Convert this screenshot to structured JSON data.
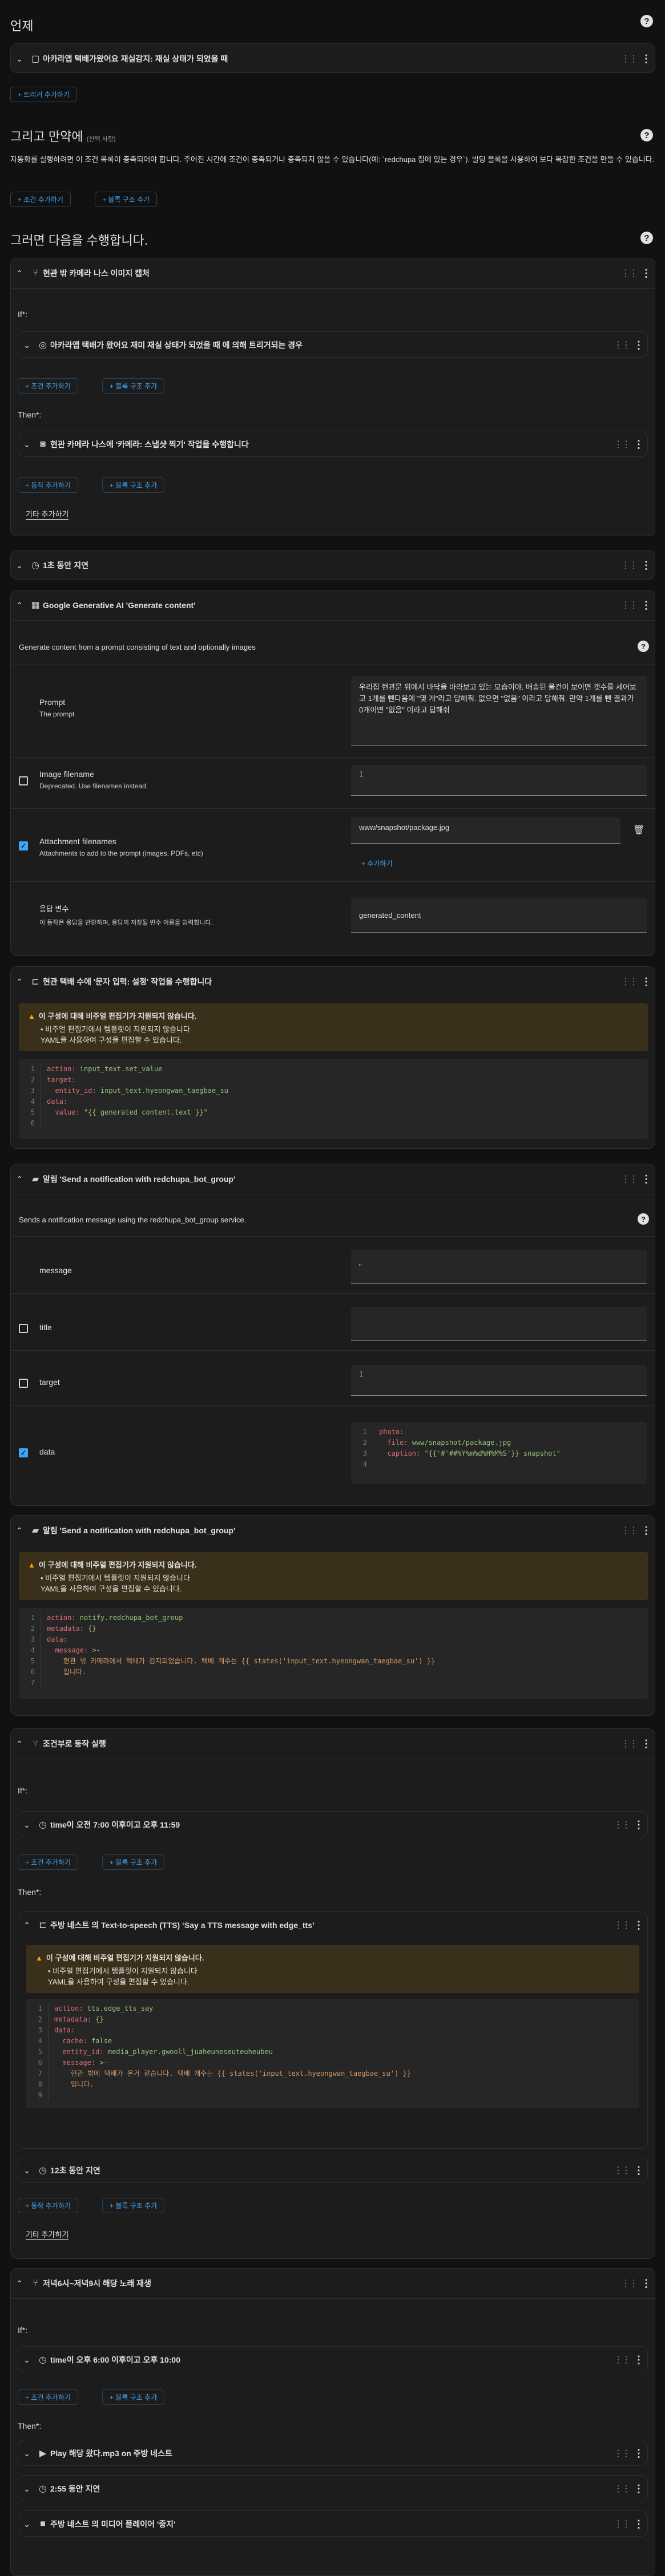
{
  "header": {
    "title": "언제"
  },
  "when": {
    "trigger_title": "아카라앱 택배가왔어요 재실감지: 재실 상태가 되었을 때",
    "add_trigger": "트리거 추가하기"
  },
  "and_if": {
    "title": "그리고 만약에",
    "optional": "(선택 사항)",
    "description": "자동화를 실행하려면 이 조건 목록이 충족되어야 합니다. 주어진 시간에 조건이 충족되거나 충족되지 않을 수 있습니다(예: `redchupa 집에 있는 경우`). 빌딩 블록을 사용하여 보다 복잡한 조건을 만들 수 있습니다.",
    "add_condition": "조건 추가하기",
    "add_block": "블록 구조 추가"
  },
  "then_do": {
    "title": "그러면 다음을 수행합니다."
  },
  "labels": {
    "if": "If*:",
    "then": "Then*:",
    "else_add": "기타 추가하기",
    "add_action": "동작 추가하기",
    "add_condition": "조건 추가하기",
    "add_block": "블록 구조 추가"
  },
  "actions": {
    "a1": {
      "title": "현관 밖 카메라 나스 이미지 캡처",
      "if_title": "아카라앱 택배가 왔어요 재미 재실 상태가 되었을 때 에 의해 트리거되는 경우",
      "then_title": "현관 카메라 나스에 '카메라: 스냅샷 찍기' 작업을 수행합니다"
    },
    "a2": {
      "title": "1초 동안 지연"
    },
    "a3": {
      "title": "Google Generative AI 'Generate content'",
      "description": "Generate content from a prompt consisting of text and optionally images",
      "prompt_label": "Prompt",
      "prompt_desc": "The prompt",
      "prompt_value": "우리집 현관문 위에서 바닥을 바라보고 있는 모습이야. 배송된 물건이 보이면 갯수를 세어보고 1개를 뺀다음에 \"몇 개\"라고 답해줘. 없으면 \"없음\" 이라고 답해줘. 만약 1개를 뺀 결과가 0개이면 \"없음\" 이라고 답해줘",
      "image_label": "Image filename",
      "image_desc": "Deprecated. Use filenames instead.",
      "image_line": "1",
      "attach_label": "Attachment filenames",
      "attach_desc": "Attachments to add to the prompt (images, PDFs, etc)",
      "attach_value": "www/snapshot/package.jpg",
      "attach_add": "추가하기",
      "resp_label": "응답 변수",
      "resp_desc": "이 동작은 응답을 반환하며, 응답의 저장될 변수 이름을 입력합니다.",
      "resp_value": "generated_content"
    },
    "a4": {
      "title": "현관 택배 수에 '문자 입력: 설정' 작업을 수행합니다",
      "warn_title": "이 구성에 대해 비주얼 편집기가 지원되지 않습니다.",
      "warn_line1": "비주얼 편집기에서 템플릿이 지원되지 않습니다",
      "warn_line2": "YAML을 사용하여 구성을 편집할 수 있습니다.",
      "code": [
        "action: input_text.set_value",
        "target:",
        "  entity_id: input_text.hyeongwan_taegbae_su",
        "data:",
        "  value: \"{{ generated_content.text }}\"",
        ""
      ]
    },
    "a5": {
      "title": "알림 'Send a notification with redchupa_bot_group'",
      "description": "Sends a notification message using the redchupa_bot_group service.",
      "message_label": "message",
      "message_value": "\"",
      "title_label": "title",
      "target_label": "target",
      "target_line": "1",
      "data_label": "data",
      "data_code": [
        "photo:",
        "  file: www/snapshot/package.jpg",
        "  caption: \"{{'#'##%Y%m%d%H%M%S'}} snapshot\"",
        ""
      ]
    },
    "a6": {
      "title": "알림 'Send a notification with redchupa_bot_group'",
      "warn_title": "이 구성에 대해 비주얼 편집기가 지원되지 않습니다.",
      "warn_line1": "비주얼 편집기에서 템플릿이 지원되지 않습니다",
      "warn_line2": "YAML을 사용하여 구성을 편집할 수 있습니다.",
      "code": [
        "action: notify.redchupa_bot_group",
        "metadata: {}",
        "data:",
        "  message: >-",
        "    현관 밖 카메라에서 택배가 감지되었습니다. 택배 개수는 {{ states('input_text.hyeongwan_taegbae_su') }}",
        "    입니다.",
        ""
      ]
    },
    "a7": {
      "title": "조건부로 동작 실행",
      "if_title": "time이 오전 7:00 이후이고 오후 11:59",
      "then_title": "주방 네스트 의 Text-to-speech (TTS) ‘Say a TTS message with edge_tts’",
      "warn_title": "이 구성에 대해 비주얼 편집기가 지원되지 않습니다.",
      "warn_line1": "비주얼 편집기에서 템플릿이 지원되지 않습니다",
      "warn_line2": "YAML을 사용하여 구성을 편집할 수 있습니다.",
      "code": [
        "action: tts.edge_tts_say",
        "metadata: {}",
        "data:",
        "  cache: false",
        "  entity_id: media_player.gwooll_juaheuneseuteuheubeu",
        "  message: >-",
        "    현관 밖에 택배가 온거 같습니다. 택배 개수는 {{ states('input_text.hyeongwan_taegbae_su') }}",
        "    입니다.",
        ""
      ],
      "delay_title": "12초 동안 지연"
    },
    "a8": {
      "title": "저녁6시~저녁9시 해당 노래 재생",
      "if_title": "time이 오후 6:00 이후이고 오후 10:00",
      "play_title": "Play 해당 왔다.mp3 on 주방 네스트",
      "delay_title": "2:55 동안 지연",
      "stop_title": "주방 네스트 의 미디어 플레이어 '중지'"
    }
  },
  "icons": {
    "chevron": "chevron-icon",
    "drag": "drag-handle-icon",
    "more": "more-vert-icon"
  },
  "colors": {
    "accent": "#41a5f5",
    "warn": "#ffa600",
    "background": "#111111",
    "card": "#1c1c1c"
  }
}
